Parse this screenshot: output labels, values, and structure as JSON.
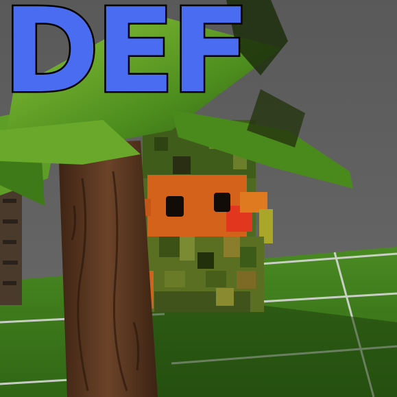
{
  "overlay": {
    "title": "DEF"
  },
  "colors": {
    "title_fill": "#4a6cf0",
    "title_stroke": "#000000",
    "sky": "#5a5a5a",
    "grass": "#3f7a1e",
    "grid_line": "#d8d8d8",
    "trunk": "#5a3a24",
    "leaves": "#4f8f1f",
    "character_face": "#d4621a",
    "character_body": "#4e6a22"
  },
  "icons": {
    "character": "camouflage-block-character-icon",
    "tree": "palm-tree-icon"
  }
}
